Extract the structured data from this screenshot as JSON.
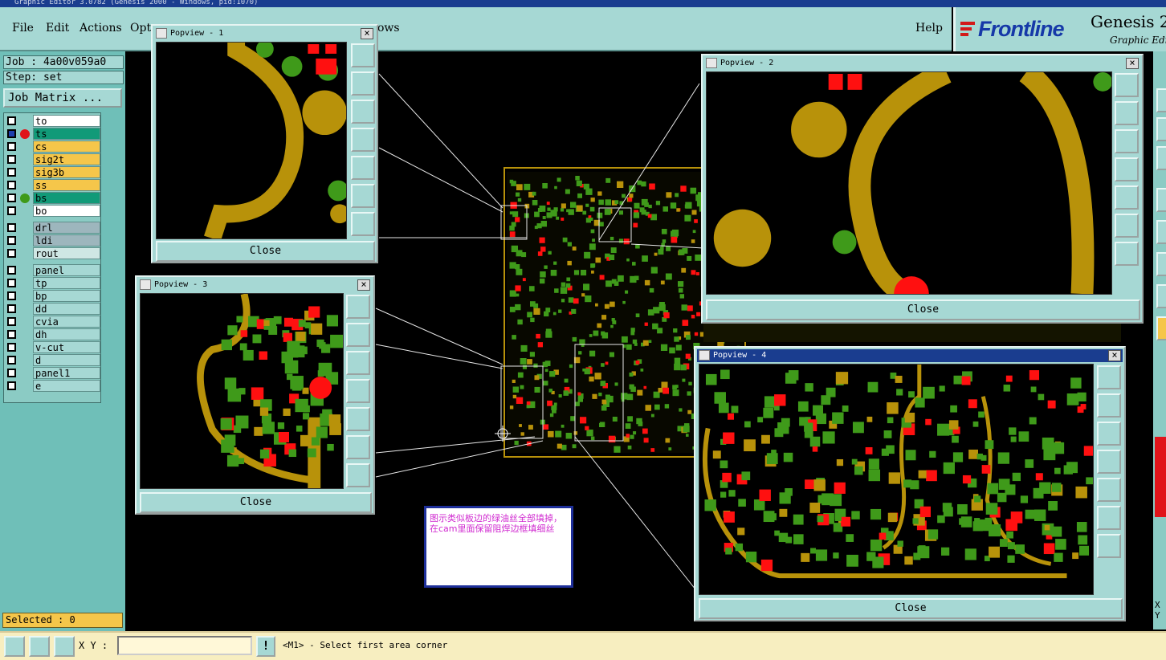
{
  "window": {
    "title": "Graphic Editor 3.0782 (Genesis 2000 - Windows, pid:1070)"
  },
  "menu": {
    "file": "File",
    "edit": "Edit",
    "actions": "Actions",
    "options": "Opt",
    "windows": "ows",
    "help": "Help"
  },
  "brand": {
    "logo": "Frontline",
    "product": "Genesis 2",
    "subtitle": "Graphic Edi"
  },
  "job": {
    "job_label": "Job : 4a00v059a0",
    "step_label": "Step: set",
    "matrix_button": "Job Matrix ..."
  },
  "layers": [
    {
      "name": "to",
      "color": "#ffffff",
      "selected": false
    },
    {
      "name": "ts",
      "color": "#119a78",
      "selected": true
    },
    {
      "name": "cs",
      "color": "#f5c64a",
      "selected": false
    },
    {
      "name": "sig2t",
      "color": "#f5c64a",
      "selected": false
    },
    {
      "name": "sig3b",
      "color": "#f5c64a",
      "selected": false
    },
    {
      "name": "ss",
      "color": "#f5c64a",
      "selected": false
    },
    {
      "name": "bs",
      "color": "#119a78",
      "selected": false
    },
    {
      "name": "bo",
      "color": "#ffffff",
      "selected": false
    },
    {
      "name": "drl",
      "color": "#9db6bd",
      "selected": false
    },
    {
      "name": "ldi",
      "color": "#9db6bd",
      "selected": false
    },
    {
      "name": "rout",
      "color": "#cfe7e4",
      "selected": false
    },
    {
      "name": "panel",
      "color": "#a6d8d4",
      "selected": false
    },
    {
      "name": "tp",
      "color": "#a6d8d4",
      "selected": false
    },
    {
      "name": "bp",
      "color": "#a6d8d4",
      "selected": false
    },
    {
      "name": "dd",
      "color": "#a6d8d4",
      "selected": false
    },
    {
      "name": "cvia",
      "color": "#a6d8d4",
      "selected": false
    },
    {
      "name": "dh",
      "color": "#a6d8d4",
      "selected": false
    },
    {
      "name": "v-cut",
      "color": "#a6d8d4",
      "selected": false
    },
    {
      "name": "d",
      "color": "#a6d8d4",
      "selected": false
    },
    {
      "name": "panel1",
      "color": "#a6d8d4",
      "selected": false
    },
    {
      "name": "e",
      "color": "#a6d8d4",
      "selected": false
    }
  ],
  "selected_text": "Selected : 0",
  "status": {
    "xy_label": "X Y :",
    "xy_value": "",
    "prompt": "<M1> - Select first area corner",
    "right_xy": "X Y"
  },
  "popviews": [
    {
      "title": "Popview - 1",
      "close": "Close"
    },
    {
      "title": "Popview - 2",
      "close": "Close"
    },
    {
      "title": "Popview - 3",
      "close": "Close"
    },
    {
      "title": "Popview - 4",
      "close": "Close"
    }
  ],
  "note": "图示类似板边的绿油丝全部填掉，在cam里面保留阻焊边框填细丝",
  "colors": {
    "panel": "#a6d8d4",
    "copper": "#b8920a",
    "green": "#3f9a1a",
    "red": "#ff1010"
  }
}
